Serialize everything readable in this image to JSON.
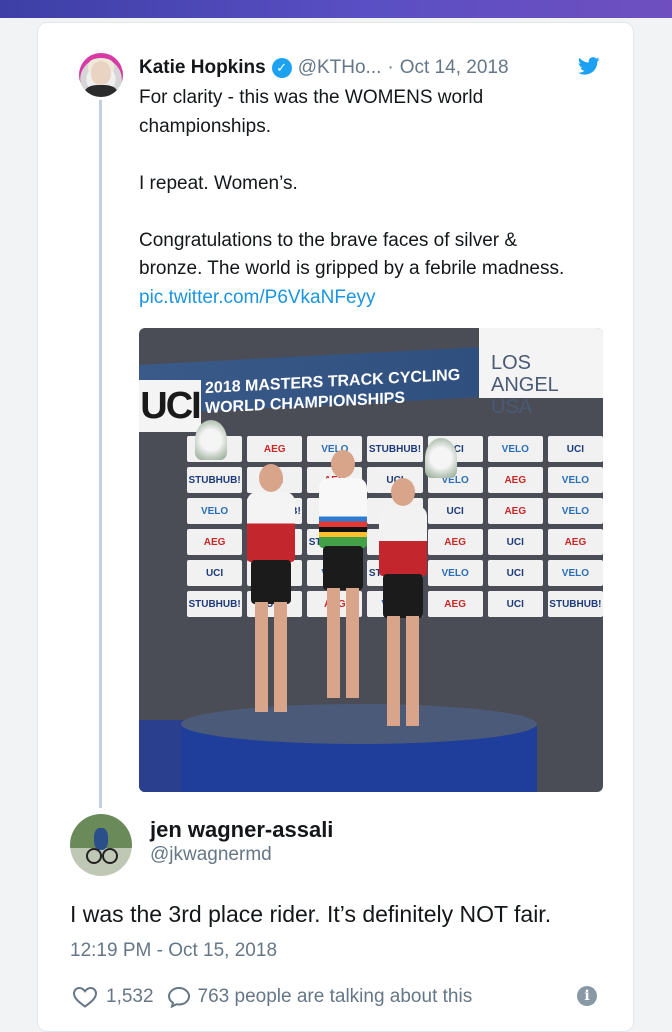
{
  "colors": {
    "accent": "#1da1f2",
    "link": "#1b95e0",
    "secondary_text": "#657786",
    "thread_line": "#c4cfe0"
  },
  "quoted_tweet": {
    "author_name": "Katie Hopkins",
    "handle": "@KTHo...",
    "separator": "·",
    "date": "Oct 14, 2018",
    "verified_icon": "verified-badge-icon",
    "paragraphs": [
      "For clarity - this was the WOMENS world championships.",
      "I repeat. Women’s."
    ],
    "last_paragraph_text": "Congratulations to the brave faces of silver & bronze. The world is gripped by a febrile madness.",
    "link_text": "pic.twitter.com/P6VkaNFeyy"
  },
  "photo": {
    "banner_brand": "UCI",
    "banner_title": "2018 MASTERS TRACK CYCLING WORLD CHAMPIONSHIPS",
    "banner_city": "LOS ANGEL USA",
    "sponsors": [
      "UCI",
      "AEG",
      "VELO",
      "STUBHUB!",
      "UCI",
      "VELO",
      "UCI",
      "STUBHUB!",
      "UCI",
      "AEG",
      "UCI",
      "VELO",
      "AEG",
      "VELO",
      "VELO",
      "STUBHUB!",
      "UCI",
      "AEG",
      "UCI",
      "AEG",
      "VELO",
      "AEG",
      "VELO",
      "STUBHUB!",
      "UCI",
      "AEG",
      "UCI",
      "AEG",
      "UCI",
      "AEG",
      "VELO",
      "STUBHUB!",
      "VELO",
      "UCI",
      "VELO",
      "STUBHUB!",
      "UCI",
      "AEG",
      "VELO",
      "AEG",
      "UCI",
      "STUBHUB!"
    ]
  },
  "reply": {
    "author_name": "jen wagner-assali",
    "handle": "@jkwagnermd",
    "text": "I was the 3rd place rider. It’s definitely NOT fair.",
    "timestamp": "12:19 PM - Oct 15, 2018",
    "like_count": "1,532",
    "talking_label": "763 people are talking about this"
  }
}
